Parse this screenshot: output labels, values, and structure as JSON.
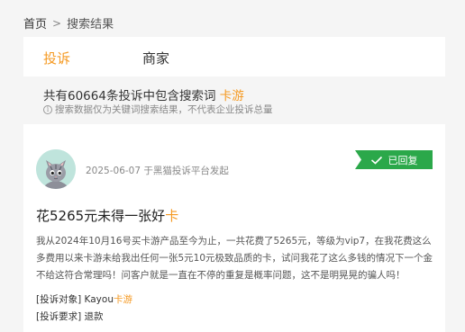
{
  "breadcrumb": {
    "home": "首页",
    "separator": ">",
    "current": "搜索结果"
  },
  "tabs": [
    {
      "label": "投诉",
      "active": true
    },
    {
      "label": "商家",
      "active": false
    }
  ],
  "summary": {
    "prefix": "共有60664条投诉中包含搜索词",
    "keyword": "卡游",
    "note": "搜索数据仅为关键词搜索结果，不代表企业投诉总量"
  },
  "complaint": {
    "date_text": "2025-06-07 于黑猫投诉平台发起",
    "status_badge": "已回复",
    "title_prefix": "花5265元未得一张好",
    "title_keyword": "卡",
    "content": "我从2024年10月16号买卡游产品至今为止，一共花费了5265元，等级为vip7，在我花费这么多费用以来卡游未给我出任何一张5元10元极致品质的卡，试问我花了这么多钱的情况下一个金不给这符合常理吗！问客户就是一直在不停的重复是概率问题，这不是明晃晃的骗人吗！",
    "target_label": "[投诉对象]",
    "target_prefix": "Kayou",
    "target_keyword": "卡游",
    "request_label": "[投诉要求]",
    "request_value": "退款"
  },
  "colors": {
    "accent": "#f59a23",
    "badge_green": "#2ba84a",
    "background": "#f5f5f5"
  },
  "icons": [
    "info-icon",
    "check-icon",
    "avatar-cat-icon"
  ]
}
